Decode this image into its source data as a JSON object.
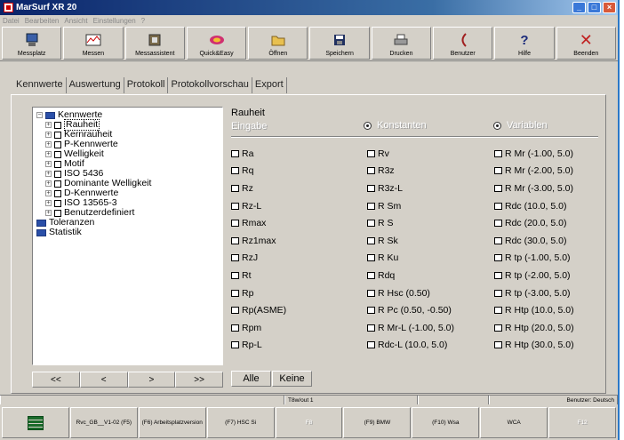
{
  "window": {
    "title": "MarSurf XR 20",
    "accent": "#0a246a"
  },
  "menu": [
    "Datei",
    "Bearbeiten",
    "Ansicht",
    "Einstellungen",
    "?"
  ],
  "toolbar": [
    {
      "label": "Messplatz",
      "icon": "workstation-icon"
    },
    {
      "label": "Messen",
      "icon": "measure-icon"
    },
    {
      "label": "Messassistent",
      "icon": "assistant-icon"
    },
    {
      "label": "Quick&Easy",
      "icon": "quick-easy-icon"
    },
    {
      "label": "Öffnen",
      "icon": "folder-open-icon"
    },
    {
      "label": "Speichern",
      "icon": "save-icon"
    },
    {
      "label": "Drucken",
      "icon": "printer-icon"
    },
    {
      "label": "Benutzer",
      "icon": "user-icon"
    },
    {
      "label": "Hilfe",
      "icon": "help-icon"
    },
    {
      "label": "Beenden",
      "icon": "exit-icon"
    }
  ],
  "tabs": [
    "Kennwerte",
    "Auswertung",
    "Protokoll",
    "Protokollvorschau",
    "Export"
  ],
  "tree": {
    "root": "Kennwerte",
    "items": [
      "Rauheit",
      "Kernrauheit",
      "P-Kennwerte",
      "Welligkeit",
      "Motif",
      "ISO 5436",
      "Dominante Welligkeit",
      "D-Kennwerte",
      "ISO 13565-3",
      "Benutzerdefiniert"
    ],
    "selected": "Rauheit",
    "others": [
      "Toleranzen",
      "Statistik"
    ]
  },
  "nav": [
    "<<",
    "<",
    ">",
    ">>"
  ],
  "section": {
    "title": "Rauheit",
    "eingabe": "Eingabe",
    "radio_konstanten": "Konstanten",
    "radio_variablen": "Variablen"
  },
  "params": {
    "col1": [
      "Ra",
      "Rq",
      "Rz",
      "Rz-L",
      "Rmax",
      "Rz1max",
      "RzJ",
      "Rt",
      "Rp",
      "Rp(ASME)",
      "Rpm",
      "Rp-L"
    ],
    "col2": [
      "Rv",
      "R3z",
      "R3z-L",
      "R Sm",
      "R S",
      "R Sk",
      "R Ku",
      "Rdq",
      "R Hsc (0.50)",
      "R Pc (0.50, -0.50)",
      "R Mr-L (-1.00, 5.0)",
      "Rdc-L (10.0, 5.0)"
    ],
    "col3": [
      "R Mr (-1.00, 5.0)",
      "R Mr (-2.00, 5.0)",
      "R Mr (-3.00, 5.0)",
      "Rdc (10.0, 5.0)",
      "Rdc (20.0, 5.0)",
      "Rdc (30.0, 5.0)",
      "R tp (-1.00, 5.0)",
      "R tp (-2.00, 5.0)",
      "R tp (-3.00, 5.0)",
      "R Htp (10.0, 5.0)",
      "R Htp (20.0, 5.0)",
      "R Htp (30.0, 5.0)"
    ]
  },
  "buttons": {
    "alle": "Alle",
    "keine": "Keine"
  },
  "status": {
    "mid": "T8w/out 1",
    "right": "Benutzer: Deutsch"
  },
  "fkeys": [
    {
      "label": "",
      "icon": "measure-stack-icon",
      "disabled": false
    },
    {
      "label": "Rvc_GB__V1-02 (F5)",
      "disabled": false
    },
    {
      "label": "(F6) Arbeitsplatzversion",
      "disabled": false
    },
    {
      "label": "(F7) HSC Si",
      "disabled": false
    },
    {
      "label": "F8",
      "disabled": true
    },
    {
      "label": "(F9) BMW",
      "disabled": false
    },
    {
      "label": "(F10) Wsa",
      "disabled": false
    },
    {
      "label": "WCA",
      "disabled": false
    },
    {
      "label": "F12",
      "disabled": true
    }
  ]
}
